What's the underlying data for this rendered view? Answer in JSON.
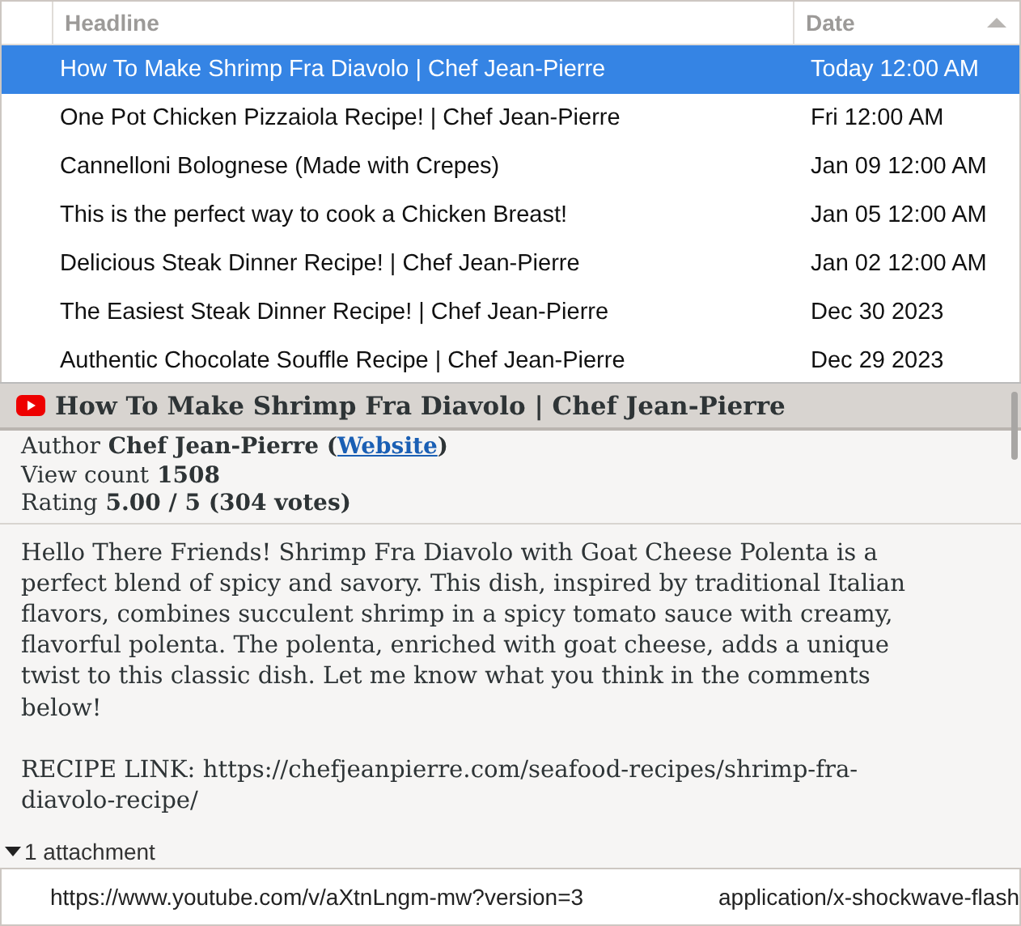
{
  "table": {
    "columns": [
      {
        "label": "Headline"
      },
      {
        "label": "Date",
        "sorted_ascending": true
      }
    ],
    "rows": [
      {
        "headline": "How To Make Shrimp Fra Diavolo | Chef Jean-Pierre",
        "date": "Today 12:00 AM",
        "selected": true
      },
      {
        "headline": "One Pot Chicken Pizzaiola Recipe! | Chef Jean-Pierre",
        "date": "Fri 12:00 AM",
        "selected": false
      },
      {
        "headline": "Cannelloni Bolognese (Made with Crepes)",
        "date": "Jan 09 12:00 AM",
        "selected": false
      },
      {
        "headline": "This is the perfect way to cook a Chicken Breast!",
        "date": "Jan 05 12:00 AM",
        "selected": false
      },
      {
        "headline": "Delicious Steak Dinner Recipe! | Chef Jean-Pierre",
        "date": "Jan 02 12:00 AM",
        "selected": false
      },
      {
        "headline": "The Easiest Steak Dinner Recipe! | Chef Jean-Pierre",
        "date": "Dec 30 2023",
        "selected": false
      },
      {
        "headline": "Authentic Chocolate Souffle Recipe | Chef Jean-Pierre",
        "date": "Dec 29 2023",
        "selected": false
      }
    ]
  },
  "article": {
    "title": "How To Make Shrimp Fra Diavolo | Chef Jean-Pierre",
    "meta": [
      {
        "label": "Author",
        "value": "Chef Jean-Pierre",
        "link_prefix": "(",
        "link": "Website",
        "link_suffix": ")"
      },
      {
        "label": "View count",
        "value": "1508"
      },
      {
        "label": "Rating",
        "value": "5.00 / 5 (304 votes)"
      }
    ],
    "paragraphs": [
      "Hello There Friends! Shrimp Fra Diavolo with Goat Cheese Polenta is a perfect blend of spicy and savory. This dish, inspired by traditional Italian flavors, combines succulent shrimp in a spicy tomato sauce with creamy, flavorful polenta. The polenta, enriched with goat cheese, adds a unique twist to this classic dish. Let me know what you think in the comments below!",
      "RECIPE LINK: https://chefjeanpierre.com/seafood-recipes/shrimp-fra-diavolo-recipe/"
    ]
  },
  "attachments": {
    "label": "1 attachment",
    "expanded": true,
    "items": [
      {
        "url": "https://www.youtube.com/v/aXtnLngm-mw?version=3",
        "type": "application/x-shockwave-flash"
      }
    ]
  }
}
